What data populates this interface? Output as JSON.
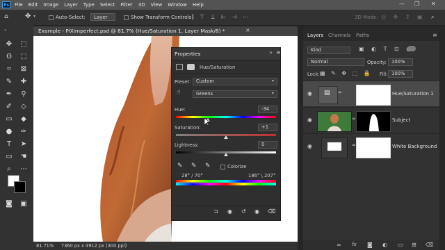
{
  "menubar": {
    "app_icon": "Ps",
    "items": [
      "File",
      "Edit",
      "Image",
      "Layer",
      "Type",
      "Select",
      "Filter",
      "3D",
      "View",
      "Window",
      "Help"
    ],
    "window_controls": [
      "—",
      "❐",
      "✕"
    ]
  },
  "optbar": {
    "auto_select_label": "Auto-Select:",
    "layer_value": "Layer",
    "show_transform_label": "Show Transform Controls",
    "mode_3d_label": "3D Mode:"
  },
  "document": {
    "tab_title": "Example - PiXimperfect.psd @ 81.7% (Hue/Saturation 1, Layer Mask/8) *",
    "close_label": "×"
  },
  "statusbar": {
    "zoom": "81.71%",
    "info": "7360 px x 4912 px (300 ppi)"
  },
  "properties": {
    "title": "Properties",
    "adj_name": "Hue/Saturation",
    "preset_label": "Preset:",
    "preset_value": "Custom",
    "channel_value": "Greens",
    "hue_label": "Hue:",
    "hue_value": "-34",
    "saturation_label": "Saturation:",
    "saturation_value": "+1",
    "lightness_label": "Lightness:",
    "lightness_value": "0",
    "colorize_label": "Colorize",
    "range_left": "28° / 70°",
    "range_right": "186° \\ 207°"
  },
  "layers_panel": {
    "tabs": [
      "Layers",
      "Channels",
      "Paths"
    ],
    "filter_kind": "Kind",
    "blend_mode": "Normal",
    "opacity_label": "Opacity:",
    "opacity_value": "100%",
    "lock_label": "Lock:",
    "fill_label": "Fill:",
    "fill_value": "100%",
    "layers": [
      {
        "name": "Hue/Saturation 1",
        "selected": true
      },
      {
        "name": "Subject",
        "selected": false
      },
      {
        "name": "White Background",
        "selected": false
      }
    ],
    "footer_icons": [
      "link-icon",
      "fx-icon",
      "mask-icon",
      "adjustment-icon",
      "folder-icon",
      "new-layer-icon",
      "trash-icon"
    ]
  },
  "colors": {
    "accent": "#31a8ff",
    "panel_bg": "#323232",
    "selected_layer": "#4a4a4a"
  }
}
